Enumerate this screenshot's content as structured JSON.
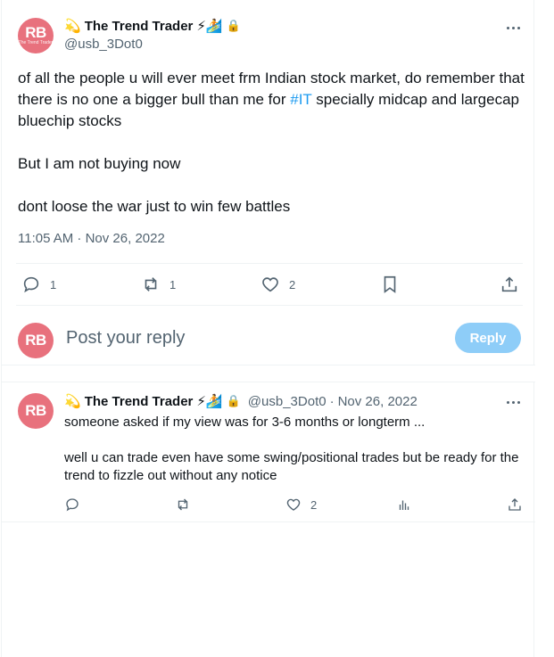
{
  "main_post": {
    "avatar_text": "RB",
    "avatar_subtext": "The Trend Trader",
    "name": "The Trend Trader",
    "emojis_before": "💫",
    "emojis_after": "⚡🏄",
    "lock_icon": "🔒",
    "handle": "@usb_3Dot0",
    "body_line1": "of all the people u will ever meet frm Indian stock market, do remember that there is no one a bigger bull than me for ",
    "hashtag": "#IT",
    "body_line1_end": " specially midcap and largecap bluechip stocks",
    "body_line2": "But I am not buying now",
    "body_line3": "dont loose the war just to win few battles",
    "timestamp": "11:05 AM · Nov 26, 2022",
    "actions": {
      "reply_count": "1",
      "repost_count": "1",
      "like_count": "2"
    }
  },
  "reply_composer": {
    "avatar_text": "RB",
    "placeholder": "Post your reply",
    "button_label": "Reply"
  },
  "reply_post": {
    "avatar_text": "RB",
    "name": "The Trend Trader",
    "emojis_before": "💫",
    "emojis_after": "⚡🏄",
    "lock_icon": "🔒",
    "handle": "@usb_3Dot0",
    "separator": "·",
    "date": "Nov 26, 2022",
    "line1": "someone asked if my view was for 3-6 months or longterm ...",
    "line2": "well u can trade even have some swing/positional trades but be ready for the trend to fizzle out without any notice",
    "like_count": "2"
  },
  "colors": {
    "accent": "#1d9bf0",
    "muted": "#536471",
    "avatar_bg": "#e8717d",
    "reply_button_bg": "#8ecdf8"
  }
}
